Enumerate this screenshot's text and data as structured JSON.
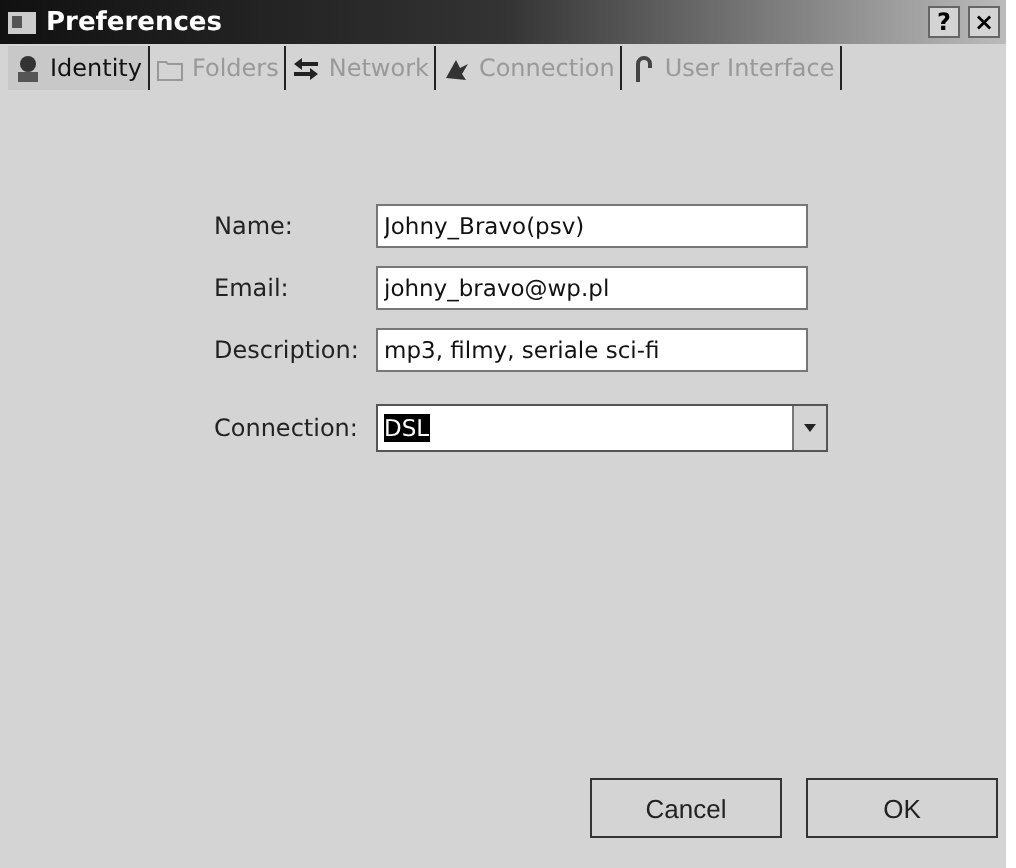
{
  "window": {
    "title": "Preferences",
    "help": "?",
    "close": "×"
  },
  "tabs": [
    {
      "label": "Identity",
      "kind": "person",
      "selected": true
    },
    {
      "label": "Folders",
      "kind": "folder",
      "selected": false
    },
    {
      "label": "Network",
      "kind": "arrows",
      "selected": false
    },
    {
      "label": "Connection",
      "kind": "bird",
      "selected": false
    },
    {
      "label": "User Interface",
      "kind": "cane",
      "selected": false
    }
  ],
  "fields": [
    {
      "label": "Name:",
      "value": "Johny_Bravo(psv)",
      "kind": "text"
    },
    {
      "label": "Email:",
      "value": "johny_bravo@wp.pl",
      "kind": "text"
    },
    {
      "label": "Description:",
      "value": "mp3, filmy, seriale sci-fi",
      "kind": "text"
    },
    {
      "label": "Connection:",
      "value": "DSL",
      "kind": "select"
    }
  ],
  "buttons": [
    "Cancel",
    "OK"
  ]
}
